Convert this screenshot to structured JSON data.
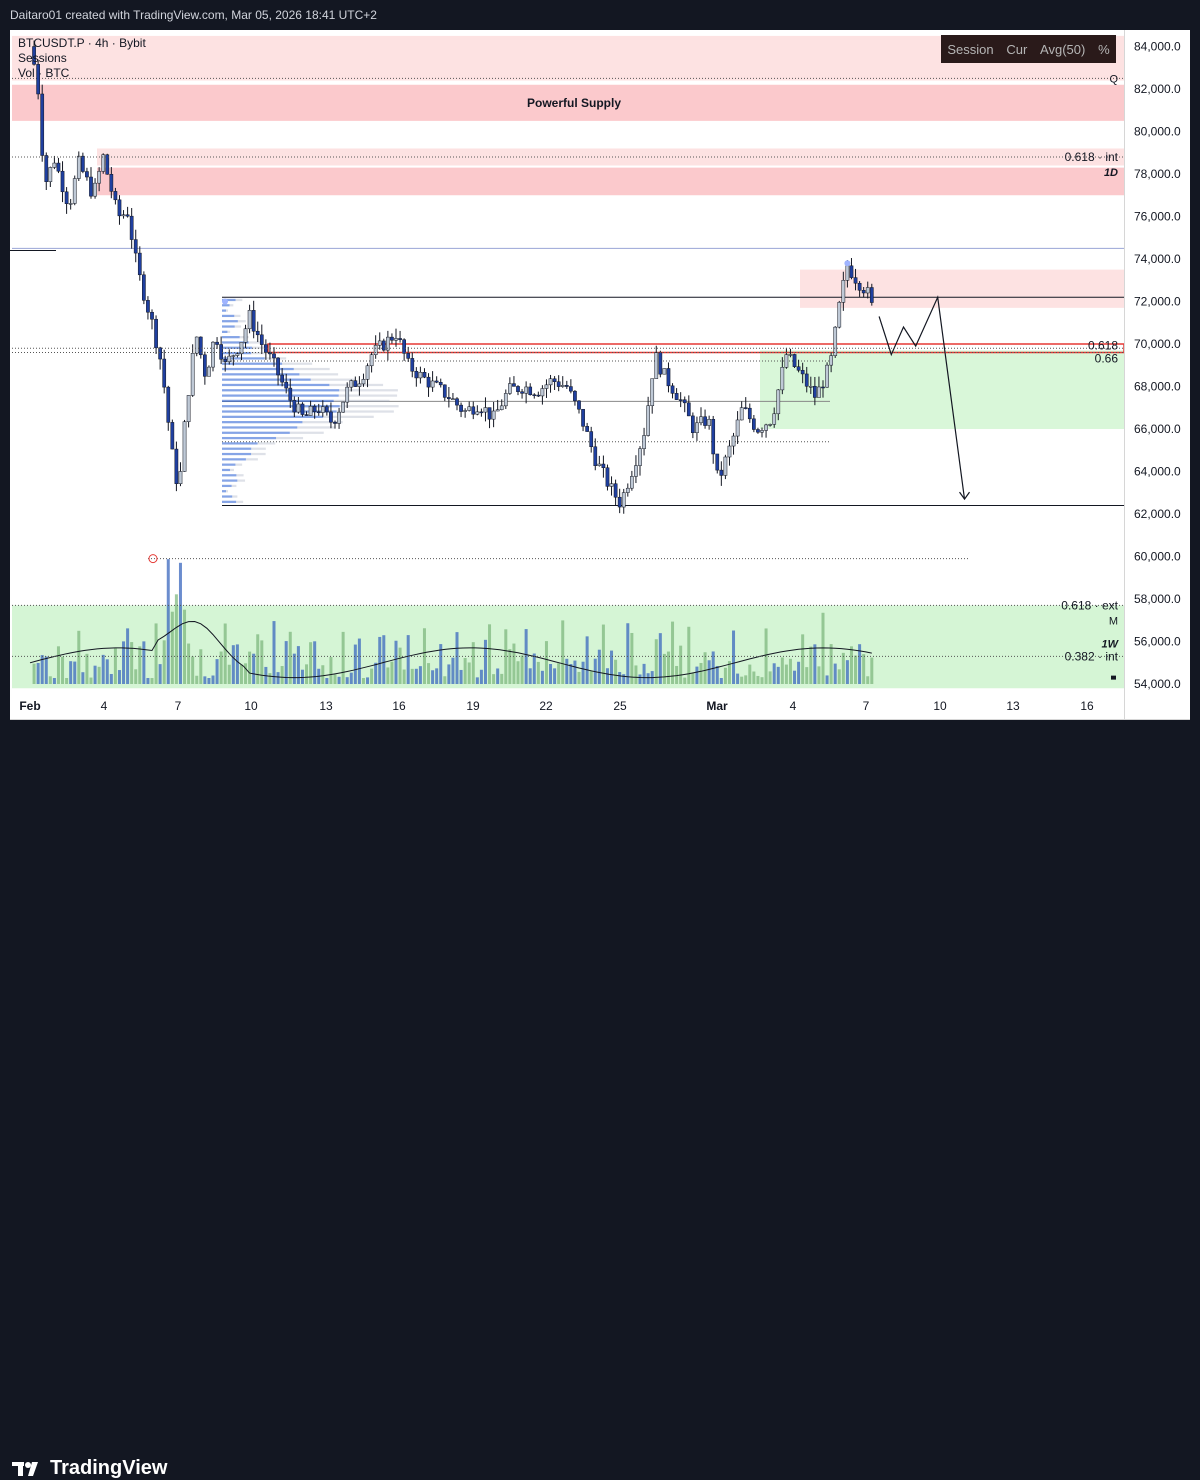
{
  "header": {
    "text": "Daitaro01 created with TradingView.com, Mar 05, 2026 18:41 UTC+2"
  },
  "legend": {
    "symbol": "BTCUSDT.P · 4h · Bybit",
    "sessions": "Sessions",
    "volume": "Vol · BTC"
  },
  "session_box": {
    "items": [
      "Session",
      "Cur",
      "Avg(50)",
      "%"
    ]
  },
  "brand": {
    "name": "TradingView"
  },
  "chart_data": {
    "type": "candlestick",
    "symbol": "BTCUSDT.P",
    "interval": "4h",
    "exchange": "Bybit",
    "ylim": [
      53500,
      85000
    ],
    "price_ticks": [
      "84,000.0",
      "82,000.0",
      "80,000.0",
      "78,000.0",
      "76,000.0",
      "74,000.0",
      "72,000.0",
      "70,000.0",
      "68,000.0",
      "66,000.0",
      "64,000.0",
      "62,000.0",
      "60,000.0",
      "58,000.0",
      "56,000.0",
      "54,000.0"
    ],
    "price_tick_values": [
      84000,
      82000,
      80000,
      78000,
      76000,
      74000,
      72000,
      70000,
      68000,
      66000,
      64000,
      62000,
      60000,
      58000,
      56000,
      54000
    ],
    "date_ticks": [
      "Feb",
      "4",
      "7",
      "10",
      "13",
      "16",
      "19",
      "22",
      "25",
      "Mar",
      "4",
      "7",
      "10",
      "13",
      "16"
    ],
    "zones": [
      {
        "label": "",
        "from": 82400,
        "to": 84500,
        "color": "#fde2e2"
      },
      {
        "label": "Powerful Supply",
        "from": 80500,
        "to": 82200,
        "color": "#fbc9cc"
      },
      {
        "label": "",
        "from": 78400,
        "to": 79200,
        "color": "#fde2e2"
      },
      {
        "label": "",
        "from": 77000,
        "to": 78300,
        "color": "#fbc9cc"
      },
      {
        "label": "",
        "from": 71700,
        "to": 73500,
        "color": "#fde2e2"
      },
      {
        "label": "",
        "from": 66000,
        "to": 69700,
        "color": "#d9f7d9"
      },
      {
        "label": "",
        "from": 53800,
        "to": 57700,
        "color": "#d5f5d5"
      }
    ],
    "levels": [
      {
        "label": "0.618 · int",
        "price": 78800
      },
      {
        "label": "0.618",
        "price": 69800
      },
      {
        "label": "0.66",
        "price": 69600
      },
      {
        "label": "0.618 · ext",
        "price": 57700
      },
      {
        "label": "0.382 · int",
        "price": 55300
      }
    ],
    "side_markers": [
      "Q",
      "1D",
      "M",
      "1W"
    ],
    "price_path": [
      {
        "d": 0,
        "p": 84000
      },
      {
        "d": 0.3,
        "p": 82500
      },
      {
        "d": 0.6,
        "p": 77500
      },
      {
        "d": 1,
        "p": 78700
      },
      {
        "d": 1.6,
        "p": 76500
      },
      {
        "d": 2,
        "p": 78500
      },
      {
        "d": 2.6,
        "p": 77000
      },
      {
        "d": 3,
        "p": 78800
      },
      {
        "d": 3.6,
        "p": 76000
      },
      {
        "d": 4,
        "p": 76200
      },
      {
        "d": 4.4,
        "p": 73500
      },
      {
        "d": 5,
        "p": 71000
      },
      {
        "d": 5.4,
        "p": 69000
      },
      {
        "d": 5.8,
        "p": 65000
      },
      {
        "d": 6.1,
        "p": 63000
      },
      {
        "d": 6.4,
        "p": 67000
      },
      {
        "d": 6.8,
        "p": 70500
      },
      {
        "d": 7.2,
        "p": 68500
      },
      {
        "d": 7.6,
        "p": 70500
      },
      {
        "d": 8,
        "p": 69000
      },
      {
        "d": 8.6,
        "p": 70000
      },
      {
        "d": 9,
        "p": 71300
      },
      {
        "d": 9.5,
        "p": 70000
      },
      {
        "d": 10,
        "p": 69000
      },
      {
        "d": 10.6,
        "p": 67500
      },
      {
        "d": 11.2,
        "p": 66500
      },
      {
        "d": 11.8,
        "p": 67000
      },
      {
        "d": 12.4,
        "p": 66300
      },
      {
        "d": 13,
        "p": 67800
      },
      {
        "d": 13.6,
        "p": 68500
      },
      {
        "d": 14,
        "p": 69500
      },
      {
        "d": 14.5,
        "p": 70000
      },
      {
        "d": 15,
        "p": 70500
      },
      {
        "d": 15.5,
        "p": 69000
      },
      {
        "d": 16,
        "p": 68500
      },
      {
        "d": 16.6,
        "p": 68000
      },
      {
        "d": 17.2,
        "p": 67500
      },
      {
        "d": 17.8,
        "p": 66800
      },
      {
        "d": 18.4,
        "p": 67200
      },
      {
        "d": 19,
        "p": 66500
      },
      {
        "d": 19.6,
        "p": 67800
      },
      {
        "d": 20.2,
        "p": 68000
      },
      {
        "d": 20.8,
        "p": 67800
      },
      {
        "d": 21.4,
        "p": 68300
      },
      {
        "d": 22,
        "p": 68000
      },
      {
        "d": 22.6,
        "p": 66500
      },
      {
        "d": 23.2,
        "p": 64500
      },
      {
        "d": 23.8,
        "p": 63200
      },
      {
        "d": 24.2,
        "p": 62500
      },
      {
        "d": 24.8,
        "p": 64500
      },
      {
        "d": 25.2,
        "p": 66000
      },
      {
        "d": 25.6,
        "p": 69500
      },
      {
        "d": 26,
        "p": 68500
      },
      {
        "d": 26.6,
        "p": 67500
      },
      {
        "d": 27.2,
        "p": 66000
      },
      {
        "d": 27.8,
        "p": 66500
      },
      {
        "d": 28.2,
        "p": 63500
      },
      {
        "d": 28.8,
        "p": 65500
      },
      {
        "d": 29.2,
        "p": 67000
      },
      {
        "d": 29.8,
        "p": 66000
      },
      {
        "d": 30.4,
        "p": 66500
      },
      {
        "d": 31,
        "p": 69500
      },
      {
        "d": 31.6,
        "p": 68500
      },
      {
        "d": 32.2,
        "p": 67500
      },
      {
        "d": 32.8,
        "p": 69000
      },
      {
        "d": 33.2,
        "p": 72000
      },
      {
        "d": 33.5,
        "p": 73700
      },
      {
        "d": 33.9,
        "p": 73000
      },
      {
        "d": 34.3,
        "p": 72500
      },
      {
        "d": 34.6,
        "p": 71400
      }
    ],
    "projection_path": [
      {
        "d": 34.8,
        "p": 71300
      },
      {
        "d": 35.3,
        "p": 69500
      },
      {
        "d": 35.8,
        "p": 70800
      },
      {
        "d": 36.3,
        "p": 69900
      },
      {
        "d": 37.2,
        "p": 72200
      },
      {
        "d": 38.3,
        "p": 62700
      }
    ]
  }
}
